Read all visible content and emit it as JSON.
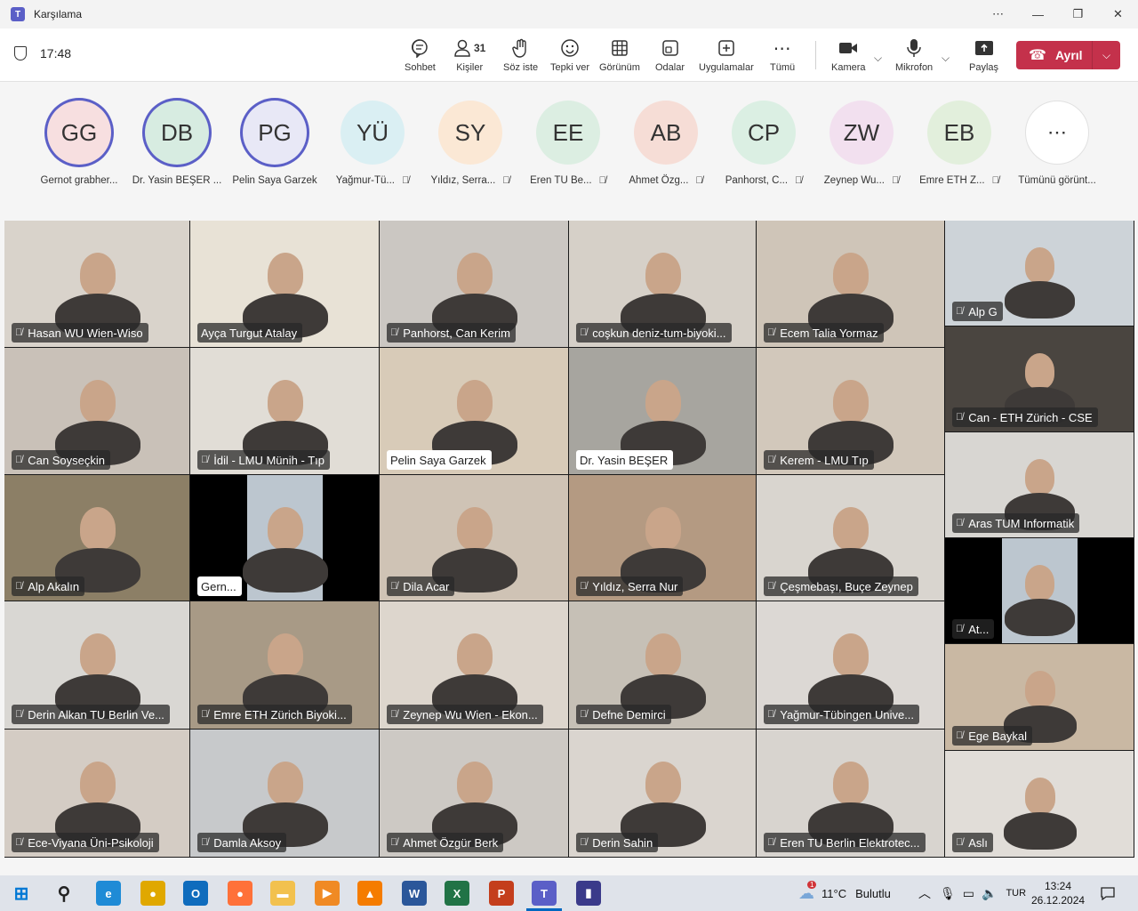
{
  "window": {
    "title": "Karşılama",
    "controls": [
      "⋯",
      "—",
      "❐",
      "✕"
    ]
  },
  "toolbar": {
    "time": "17:48",
    "people_count": "31",
    "tools": [
      {
        "label": "Sohbet",
        "icon": "chat-icon"
      },
      {
        "label": "Kişiler",
        "icon": "people-icon"
      },
      {
        "label": "Söz iste",
        "icon": "raise-hand-icon"
      },
      {
        "label": "Tepki ver",
        "icon": "smile-icon"
      },
      {
        "label": "Görünüm",
        "icon": "grid-icon"
      },
      {
        "label": "Odalar",
        "icon": "rooms-icon"
      },
      {
        "label": "Uygulamalar",
        "icon": "apps-icon"
      },
      {
        "label": "Tümü",
        "icon": "more-icon"
      },
      {
        "label": "Kamera",
        "icon": "camera-icon"
      },
      {
        "label": "Mikrofon",
        "icon": "mic-icon"
      },
      {
        "label": "Paylaş",
        "icon": "share-icon"
      }
    ],
    "leave_label": "Ayrıl"
  },
  "strip": {
    "participants": [
      {
        "initials": "GG",
        "name": "Gernot grabher...",
        "bg": "#f7dfe0",
        "muted": false,
        "active": true
      },
      {
        "initials": "DB",
        "name": "Dr. Yasin BEŞER ...",
        "bg": "#d7ece1",
        "muted": false,
        "active": true
      },
      {
        "initials": "PG",
        "name": "Pelin Saya Garzek",
        "bg": "#e8e8f6",
        "muted": false,
        "active": true
      },
      {
        "initials": "YÜ",
        "name": "Yağmur-Tü...",
        "bg": "#daeff3",
        "muted": true,
        "active": false
      },
      {
        "initials": "SY",
        "name": "Yıldız, Serra...",
        "bg": "#fbe8d5",
        "muted": true,
        "active": false
      },
      {
        "initials": "EE",
        "name": "Eren TU Be...",
        "bg": "#dceee2",
        "muted": true,
        "active": false
      },
      {
        "initials": "AB",
        "name": "Ahmet Özg...",
        "bg": "#f6ddd6",
        "muted": true,
        "active": false
      },
      {
        "initials": "CP",
        "name": "Panhorst, C...",
        "bg": "#dbefe3",
        "muted": true,
        "active": false
      },
      {
        "initials": "ZW",
        "name": "Zeynep Wu...",
        "bg": "#f2e0ef",
        "muted": true,
        "active": false
      },
      {
        "initials": "EB",
        "name": "Emre ETH Z...",
        "bg": "#e2efdc",
        "muted": true,
        "active": false
      },
      {
        "initials": "⋯",
        "name": "Tümünü görünt...",
        "bg": "#ffffff",
        "muted": false,
        "active": false
      }
    ]
  },
  "grid": {
    "tiles": [
      {
        "name": "Hasan WU Wien-Wiso",
        "muted": true,
        "bg": "#d9d3cb"
      },
      {
        "name": "Ayça Turgut Atalay",
        "muted": false,
        "bg": "#e8e2d6"
      },
      {
        "name": "Panhorst, Can Kerim",
        "muted": true,
        "bg": "#cbc7c2"
      },
      {
        "name": "coşkun deniz-tum-biyoki...",
        "muted": true,
        "bg": "#d6d0c8"
      },
      {
        "name": "Ecem Talia Yormaz",
        "muted": true,
        "bg": "#cfc5b8"
      },
      {
        "name": "Alp G",
        "muted": true,
        "bg": "#cdd3d8"
      },
      {
        "name": "Can Soyseçkin",
        "muted": true,
        "bg": "#c9c1b8"
      },
      {
        "name": "İdil - LMU Münih - Tıp",
        "muted": true,
        "bg": "#e1ddd6"
      },
      {
        "name": "Pelin Saya Garzek",
        "muted": false,
        "bg": "#d8cbb8",
        "light": true
      },
      {
        "name": "Dr. Yasin BEŞER",
        "muted": false,
        "bg": "#a7a59f",
        "light": true
      },
      {
        "name": "Kerem - LMU Tıp",
        "muted": true,
        "bg": "#d2c8bb"
      },
      {
        "name": "Can - ETH Zürich - CSE",
        "muted": true,
        "bg": "#4a4540"
      },
      {
        "name": "Alp Akalın",
        "muted": true,
        "bg": "#8c7f66"
      },
      {
        "name": "Gern...",
        "muted": false,
        "bg": "#000000",
        "light": true
      },
      {
        "name": "Dila Acar",
        "muted": true,
        "bg": "#cfc3b5"
      },
      {
        "name": "Yıldız, Serra Nur",
        "muted": true,
        "bg": "#b49a82"
      },
      {
        "name": "Çeşmebaşı, Buçe Zeynep",
        "muted": true,
        "bg": "#d9d5cf"
      },
      {
        "name": "Aras TUM Informatik",
        "muted": true,
        "bg": "#d8d6d2"
      },
      {
        "name": "At...",
        "muted": true,
        "bg": "#000000"
      },
      {
        "name": "Derin Alkan TU Berlin Ve...",
        "muted": true,
        "bg": "#d9d7d3"
      },
      {
        "name": "Emre ETH Zürich Biyoki...",
        "muted": true,
        "bg": "#a89a86"
      },
      {
        "name": "Zeynep Wu Wien - Ekon...",
        "muted": true,
        "bg": "#ddd6cd"
      },
      {
        "name": "Defne Demirci",
        "muted": true,
        "bg": "#c6c0b6"
      },
      {
        "name": "Yağmur-Tübingen Unive...",
        "muted": true,
        "bg": "#dcd8d4"
      },
      {
        "name": "Ege Baykal",
        "muted": true,
        "bg": "#c9b8a3"
      },
      {
        "name": "Ece-Viyana Üni-Psikoloji",
        "muted": true,
        "bg": "#d4ccc4"
      },
      {
        "name": "Damla Aksoy",
        "muted": true,
        "bg": "#c7c9cb"
      },
      {
        "name": "Ahmet Özgür Berk",
        "muted": true,
        "bg": "#cdc9c4"
      },
      {
        "name": "Derin Sahin",
        "muted": true,
        "bg": "#dad5cf"
      },
      {
        "name": "Eren TU Berlin Elektrotec...",
        "muted": true,
        "bg": "#d8d4cf"
      },
      {
        "name": "Aslı",
        "muted": true,
        "bg": "#e1ddd8"
      }
    ]
  },
  "taskbar": {
    "apps": [
      {
        "name": "start-icon",
        "label": "⊞",
        "color": "#0078d4"
      },
      {
        "name": "search-icon",
        "label": "⚲",
        "color": "#222222"
      },
      {
        "name": "edge-icon",
        "label": "e",
        "color": "#1f8bd6"
      },
      {
        "name": "chrome-icon",
        "label": "●",
        "color": "#e0a800"
      },
      {
        "name": "outlook-icon",
        "label": "O",
        "color": "#0f6cbd"
      },
      {
        "name": "firefox-icon",
        "label": "●",
        "color": "#ff7139"
      },
      {
        "name": "explorer-icon",
        "label": "▬",
        "color": "#f2c14e"
      },
      {
        "name": "media-player-icon",
        "label": "▶",
        "color": "#f08a24"
      },
      {
        "name": "vlc-icon",
        "label": "▲",
        "color": "#f57c00"
      },
      {
        "name": "word-icon",
        "label": "W",
        "color": "#2b579a"
      },
      {
        "name": "excel-icon",
        "label": "X",
        "color": "#217346"
      },
      {
        "name": "powerpoint-icon",
        "label": "P",
        "color": "#c43e1c"
      },
      {
        "name": "teams-icon",
        "label": "T",
        "color": "#5b5fc7"
      },
      {
        "name": "stocks-icon",
        "label": "▮",
        "color": "#3a3a8a"
      }
    ],
    "weather_temp": "11°C",
    "weather_desc": "Bulutlu",
    "weather_badge": "1",
    "lang": "TUR",
    "time": "13:24",
    "date": "26.12.2024"
  }
}
